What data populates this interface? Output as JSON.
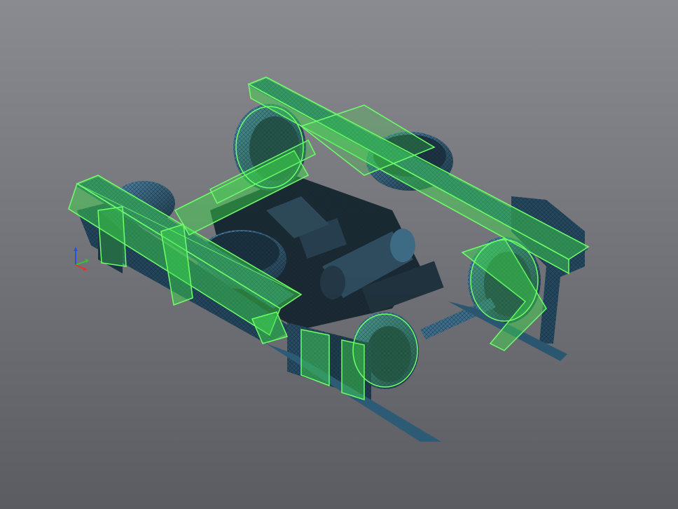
{
  "viewport": {
    "background_top": "#8a8b90",
    "background_bottom": "#5b5c61"
  },
  "model": {
    "surface_color": "#3b6f8f",
    "surface_dark": "#1e3a4c",
    "mesh_color": "#10212b",
    "overlay_fill": "#3fe04b",
    "overlay_stroke": "#6dff6a"
  },
  "triad": {
    "x_color": "#e0352a",
    "y_color": "#35c33a",
    "z_color": "#2d4fe0",
    "icon": "coordinate-axes-icon"
  }
}
